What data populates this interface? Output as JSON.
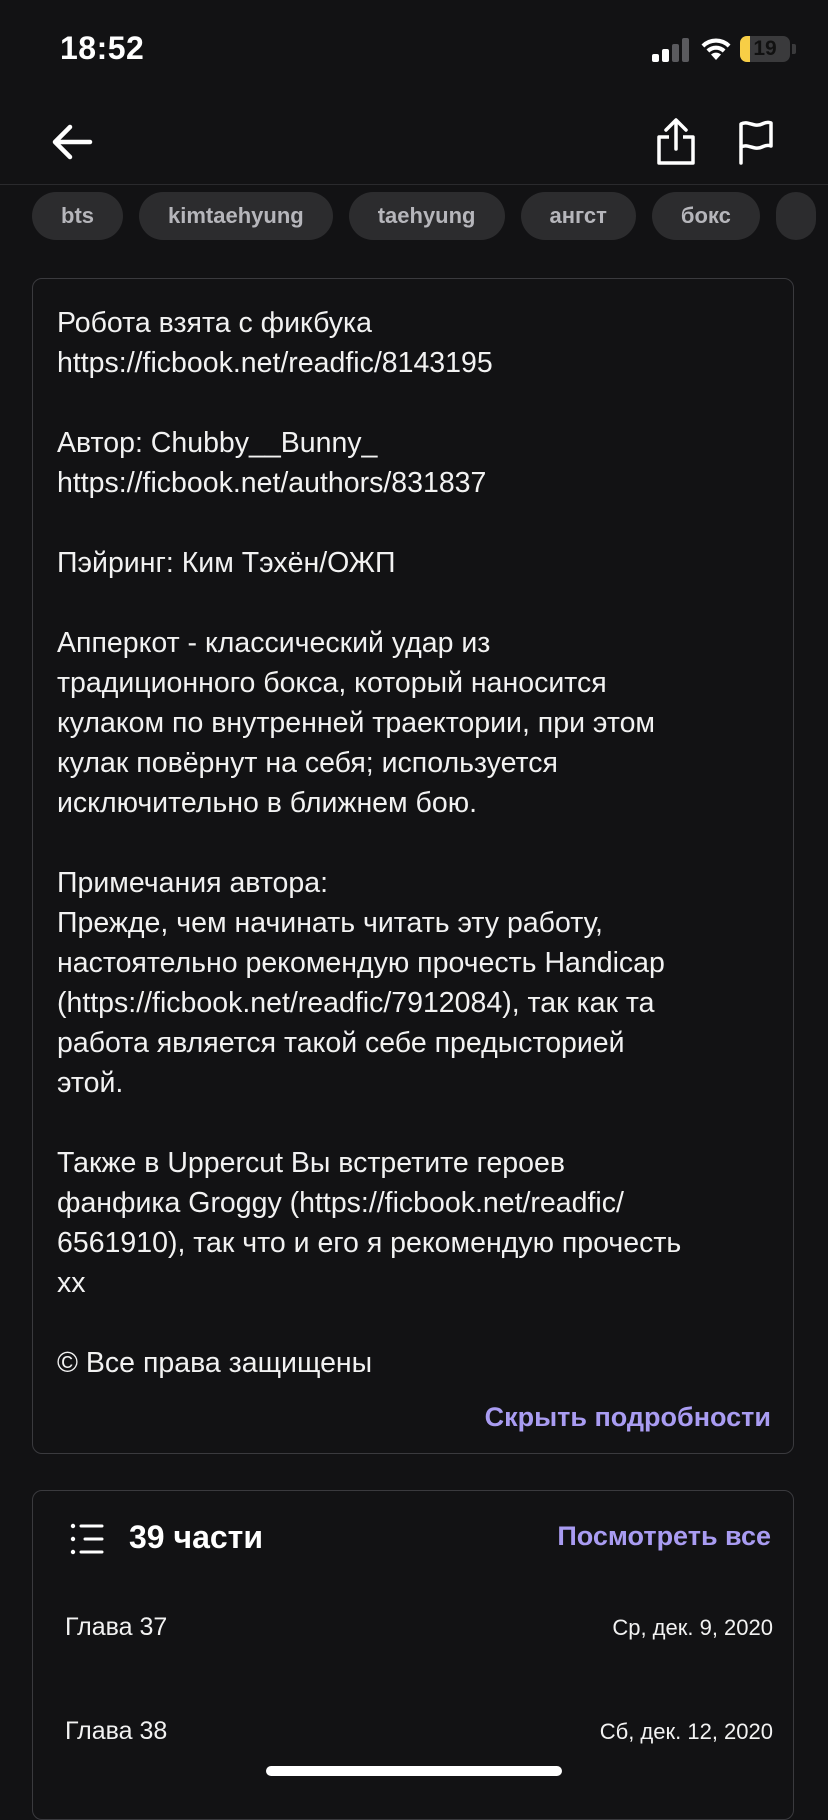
{
  "status_bar": {
    "time": "18:52",
    "battery_level": "19",
    "battery_fraction": 0.19,
    "colors": {
      "battery_low": "#f7ce46",
      "signal_active": "#ffffff",
      "signal_inactive": "#5a5a5e"
    },
    "icons": [
      "signal-icon",
      "wifi-icon",
      "battery-icon"
    ]
  },
  "nav": {
    "icons": [
      "back-arrow-icon",
      "share-icon",
      "flag-icon"
    ]
  },
  "tags": [
    "bts",
    "kimtaehyung",
    "taehyung",
    "ангст",
    "бокс"
  ],
  "description": {
    "text": "Робота взята с фикбука\nhttps://ficbook.net/readfic/8143195\n\nАвтор: Chubby__Bunny_\nhttps://ficbook.net/authors/831837\n\nПэйринг: Ким Тэхён/ОЖП\n\nАпперкот - классический удар из\nтрадиционного бокса, который наносится\nкулаком по внутренней траектории, при этом\nкулак повёрнут на себя; используется\nисключительно в ближнем бою.\n\nПримечания автора:\nПрежде, чем начинать читать эту работу,\nнастоятельно рекомендую прочесть Handicap\n(https://ficbook.net/readfic/7912084), так как та\nработа является такой себе предысторией\nэтой.\n\nТакже в Uppercut Вы встретите героев\nфанфика Groggy (https://ficbook.net/readfic/\n6561910), так что и его я рекомендую прочесть\nхх\n\n© Все права защищены",
    "hide_label": "Скрыть подробности"
  },
  "parts": {
    "icon": "list-icon",
    "title": "39 части",
    "view_all_label": "Посмотреть все",
    "chapters": [
      {
        "name": "Глава 37",
        "date": "Ср, дек. 9, 2020"
      },
      {
        "name": "Глава 38",
        "date": "Сб, дек. 12, 2020"
      }
    ]
  },
  "colors": {
    "background": "#121214",
    "accent": "#a99cf2",
    "tag_bg": "#2c2c2e",
    "tag_text": "#b6b6bb",
    "card_border": "#3a3a3e"
  }
}
